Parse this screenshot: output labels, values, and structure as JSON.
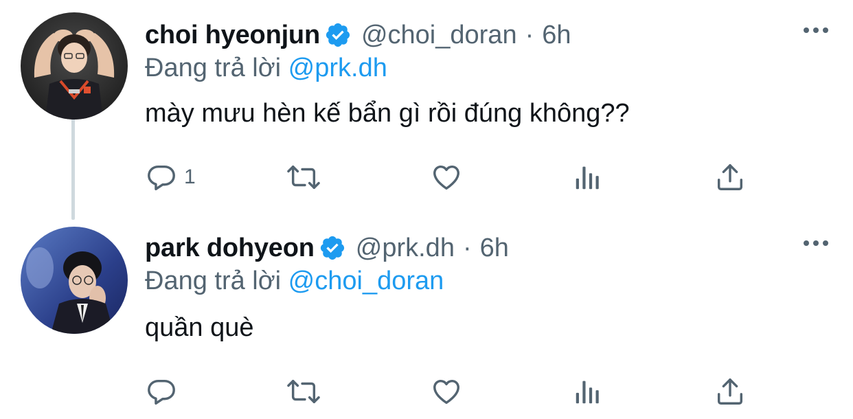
{
  "tweets": [
    {
      "display_name": "choi hyeonjun",
      "handle": "@choi_doran",
      "separator": "·",
      "time": "6h",
      "reply_prefix": "Đang trả lời",
      "reply_mention": "@prk.dh",
      "text": "mày mưu hèn kế bẩn gì rồi đúng không??",
      "reply_count": "1"
    },
    {
      "display_name": "park dohyeon",
      "handle": "@prk.dh",
      "separator": "·",
      "time": "6h",
      "reply_prefix": "Đang trả lời",
      "reply_mention": "@choi_doran",
      "text": "quần què",
      "reply_count": ""
    }
  ],
  "icons": {
    "verified": "verified-badge-icon",
    "more": "more-dots-icon",
    "reply": "reply-icon",
    "retweet": "retweet-icon",
    "like": "like-icon",
    "views": "views-icon",
    "share": "share-icon"
  },
  "colors": {
    "verified": "#1d9bf0",
    "mention": "#1d9bf0",
    "secondary_text": "#536471",
    "primary_text": "#0f1419",
    "thread_line": "#cfd9de"
  }
}
